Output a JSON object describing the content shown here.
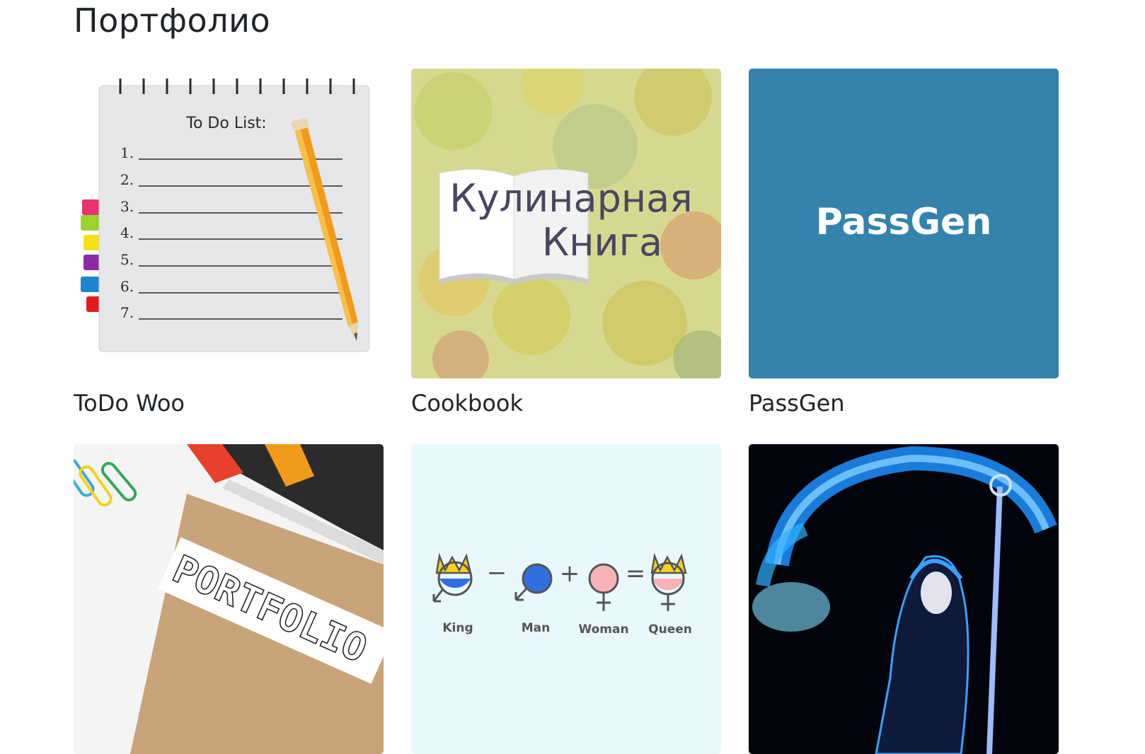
{
  "page": {
    "title": "Портфолио"
  },
  "projects": [
    {
      "title": "ToDo Woo",
      "image": {
        "heading": "To Do List:",
        "lines": [
          "1.",
          "2.",
          "3.",
          "4.",
          "5.",
          "6.",
          "7."
        ],
        "colors": {
          "paper": "#e6e7e9",
          "pencil": "#f29a1c",
          "tabs": [
            "#e8336f",
            "#9bd22c",
            "#f3e21a",
            "#8c2aa6",
            "#1a86d0",
            "#e21b23"
          ]
        }
      }
    },
    {
      "title": "Cookbook",
      "image": {
        "line1": "Кулинарная",
        "line2": "Книга",
        "colors": {
          "background": "#d7d890",
          "text": "#4a4660"
        }
      }
    },
    {
      "title": "PassGen",
      "image": {
        "logo": "PassGen",
        "colors": {
          "background": "#3383ad",
          "text": "#ffffff"
        }
      }
    },
    {
      "title": "",
      "image": {
        "label": "PORTFOLIO",
        "colors": {
          "folder": "#c9a47a"
        }
      }
    },
    {
      "title": "",
      "image": {
        "labels": [
          "King",
          "Man",
          "Woman",
          "Queen"
        ],
        "operators": [
          "−",
          "+",
          "="
        ],
        "colors": {
          "background": "#e9f8fc",
          "male": "#2f6fe0",
          "female": "#f7b3b8",
          "crown": "#f6d21c",
          "text": "#555555"
        }
      }
    },
    {
      "title": "",
      "image": {
        "icon": "wizard-art",
        "colors": {
          "background": "#02040c",
          "glow": "#1e90ff"
        }
      }
    }
  ]
}
